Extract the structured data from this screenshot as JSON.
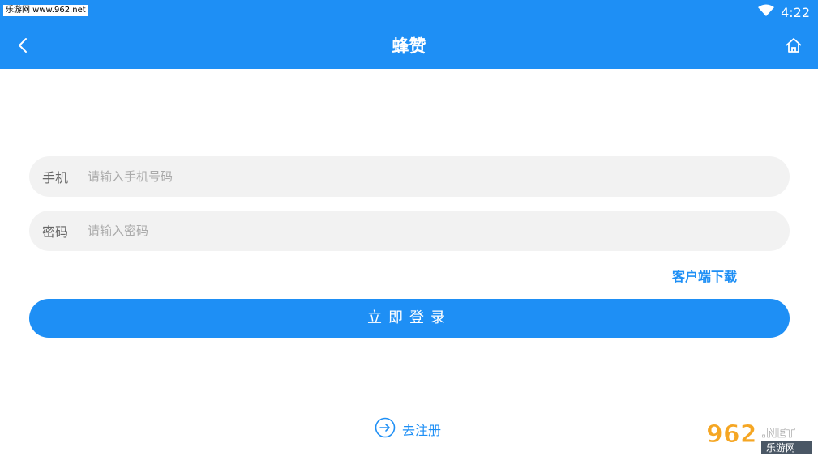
{
  "status_bar": {
    "watermark": "乐游网 www.962.net",
    "time": "4:22"
  },
  "app_bar": {
    "title": "蜂赞",
    "back_icon": "chevron-left-icon",
    "home_icon": "home-icon"
  },
  "form": {
    "phone": {
      "label": "手机",
      "placeholder": "请输入手机号码",
      "value": ""
    },
    "password": {
      "label": "密码",
      "placeholder": "请输入密码",
      "value": ""
    },
    "download_link": "客户端下载",
    "login_button": "立即登录",
    "register_link": "去注册"
  },
  "watermark_brand": {
    "number": "962",
    "suffix": ".NET",
    "site_name": "乐游网"
  },
  "colors": {
    "primary": "#1e8ff5",
    "field_bg": "#f2f2f2",
    "placeholder": "#aaaaaa"
  }
}
